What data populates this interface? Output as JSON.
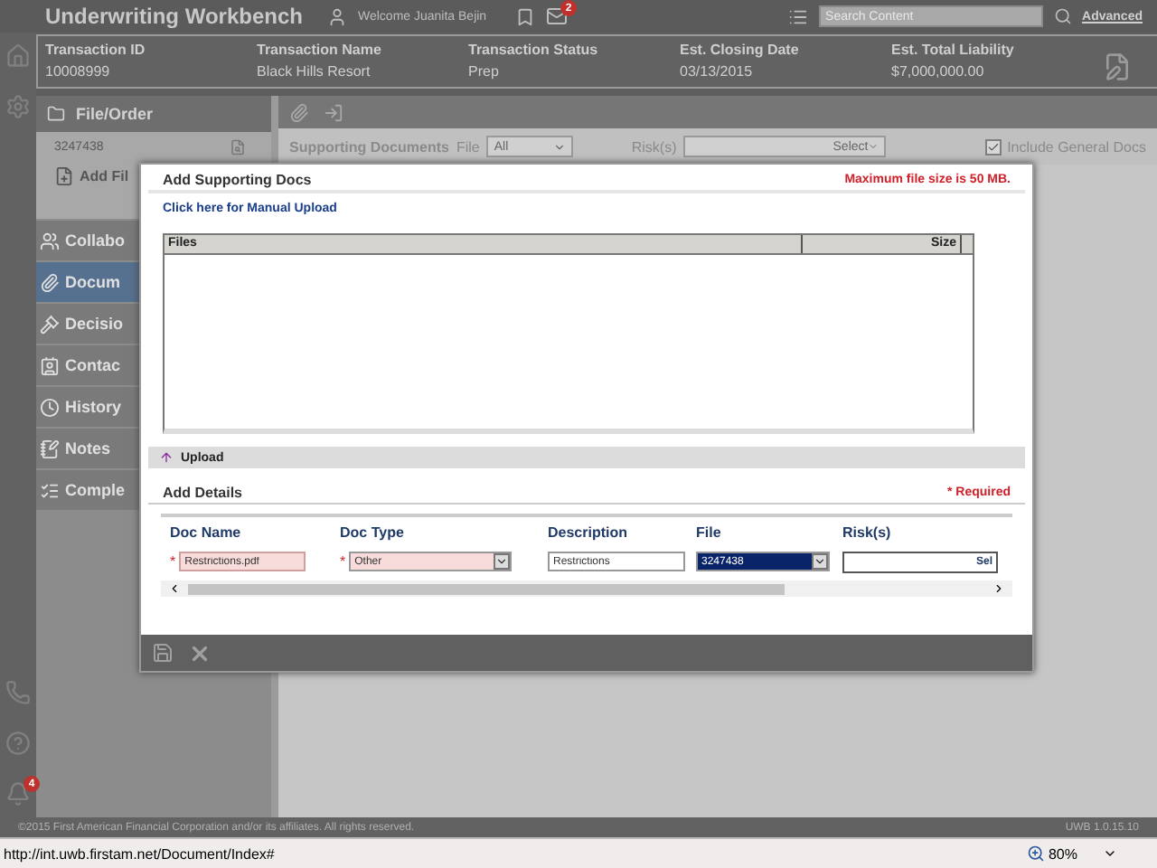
{
  "header": {
    "title": "Underwriting Workbench",
    "welcome": "Welcome Juanita Bejin",
    "mail_badge": "2",
    "search_placeholder": "Search Content",
    "advanced": "Advanced"
  },
  "transaction": [
    {
      "label": "Transaction ID",
      "value": "10008999"
    },
    {
      "label": "Transaction Name",
      "value": "Black Hills Resort"
    },
    {
      "label": "Transaction Status",
      "value": "Prep"
    },
    {
      "label": "Est. Closing Date",
      "value": "03/13/2015"
    },
    {
      "label": "Est. Total Liability",
      "value": "$7,000,000.00"
    }
  ],
  "sidebar": {
    "title": "File/Order",
    "file_number": "3247438",
    "add_file": "Add Fil",
    "items": [
      {
        "label": "Collabo",
        "selected": false
      },
      {
        "label": "Docum",
        "selected": true
      },
      {
        "label": "Decisio",
        "selected": false
      },
      {
        "label": "Contac",
        "selected": false
      },
      {
        "label": "History",
        "selected": false
      },
      {
        "label": "Notes",
        "selected": false
      },
      {
        "label": "Comple",
        "selected": false
      }
    ]
  },
  "filters": {
    "title": "Supporting Documents",
    "file_label": "File",
    "file_value": "All",
    "risk_label": "Risk(s)",
    "risk_placeholder": "Select",
    "include_general": {
      "label": "Include General Docs",
      "checked": true
    }
  },
  "modal": {
    "title": "Add Supporting Docs",
    "max_size": "Maximum file size is 50 MB.",
    "manual_upload": "Click here for Manual Upload",
    "files_columns": [
      "Files",
      "Size"
    ],
    "upload": "Upload",
    "details_title": "Add Details",
    "required": "* Required",
    "details_columns": [
      "Doc Name",
      "Doc Type",
      "Description",
      "File",
      "Risk(s)"
    ],
    "row": {
      "doc_name": {
        "value": "Restrictions.pdf",
        "required_mark": "*"
      },
      "doc_type": {
        "value": "Other",
        "required_mark": "*"
      },
      "description": {
        "value": "Restrictions"
      },
      "file": {
        "value": "3247438",
        "selected": true
      },
      "risks_button": "Sel"
    }
  },
  "notifications_badge": "4",
  "footer": {
    "copyright": "©2015 First American Financial Corporation and/or its affiliates. All rights reserved.",
    "version": "UWB 1.0.15.10"
  },
  "browser": {
    "url": "http://int.uwb.firstam.net/Document/Index#",
    "zoom": "80%"
  }
}
